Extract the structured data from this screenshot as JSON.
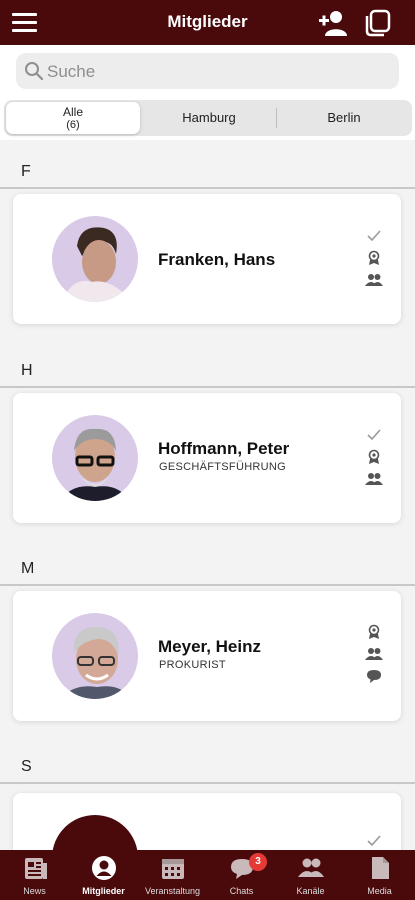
{
  "header": {
    "title": "Mitglieder"
  },
  "search": {
    "placeholder": "Suche"
  },
  "segments": [
    {
      "label": "Alle",
      "count": "(6)"
    },
    {
      "label": "Hamburg"
    },
    {
      "label": "Berlin"
    }
  ],
  "sections": [
    "F",
    "H",
    "M",
    "S"
  ],
  "members": [
    {
      "name": "Franken, Hans",
      "role": "",
      "icons": [
        "check-icon",
        "award-icon",
        "group-icon"
      ]
    },
    {
      "name": "Hoffmann, Peter",
      "role": "GESCHÄFTSFÜHRUNG",
      "icons": [
        "check-icon",
        "award-icon",
        "group-icon"
      ]
    },
    {
      "name": "Meyer, Heinz",
      "role": "PROKURIST",
      "icons": [
        "award-icon",
        "group-icon",
        "chat-icon"
      ]
    },
    {
      "name": "",
      "role": "",
      "icons": [
        "check-icon"
      ]
    }
  ],
  "tabbar": {
    "items": [
      {
        "label": "News",
        "icon": "news-icon"
      },
      {
        "label": "Mitglieder",
        "icon": "member-icon",
        "active": true
      },
      {
        "label": "Veranstaltung",
        "icon": "calendar-icon"
      },
      {
        "label": "Chats",
        "icon": "chat-icon",
        "badge": "3"
      },
      {
        "label": "Kanäle",
        "icon": "channels-icon"
      },
      {
        "label": "Media",
        "icon": "document-icon"
      }
    ]
  },
  "colors": {
    "brand": "#4a0a0c",
    "badge": "#e53935",
    "avatar_bg": "#d8c9e6"
  }
}
